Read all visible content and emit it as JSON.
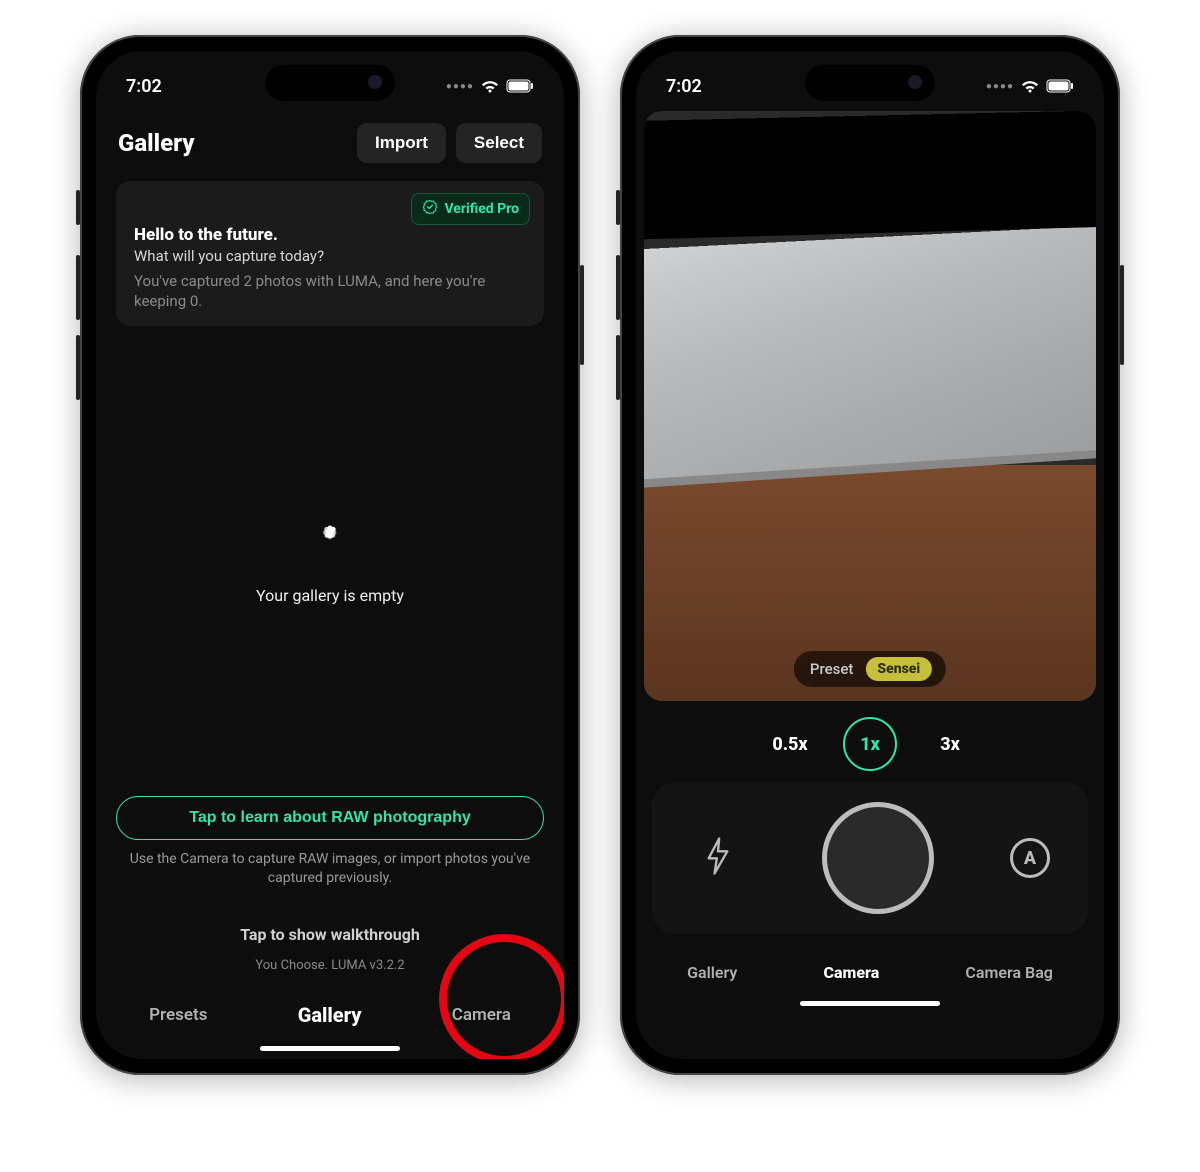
{
  "colors": {
    "accent": "#2ee6a8",
    "highlight": "#e30613",
    "preset_chip": "#c5bf3a"
  },
  "status": {
    "time": "7:02"
  },
  "gallery": {
    "title": "Gallery",
    "buttons": {
      "import": "Import",
      "select": "Select"
    },
    "verified_label": "Verified Pro",
    "headline": "Hello to the future.",
    "subhead": "What will you capture today?",
    "body": "You've captured 2 photos with LUMA, and here you're keeping 0.",
    "empty": "Your gallery is empty",
    "raw_cta": "Tap to learn about RAW photography",
    "raw_hint": "Use the Camera to capture RAW images, or import photos you've captured previously.",
    "walkthrough": "Tap to show walkthrough",
    "version": "You Choose. LUMA v3.2.2",
    "tabs": [
      "Presets",
      "Gallery",
      "Camera"
    ],
    "active_tab": 1,
    "highlighted_tab": 2
  },
  "camera": {
    "preset_label": "Preset",
    "preset_name": "Sensei",
    "zoom_levels": [
      "0.5x",
      "1x",
      "3x"
    ],
    "active_zoom": 1,
    "auto_label": "A",
    "tabs": [
      "Gallery",
      "Camera",
      "Camera Bag"
    ],
    "active_tab": 1
  }
}
